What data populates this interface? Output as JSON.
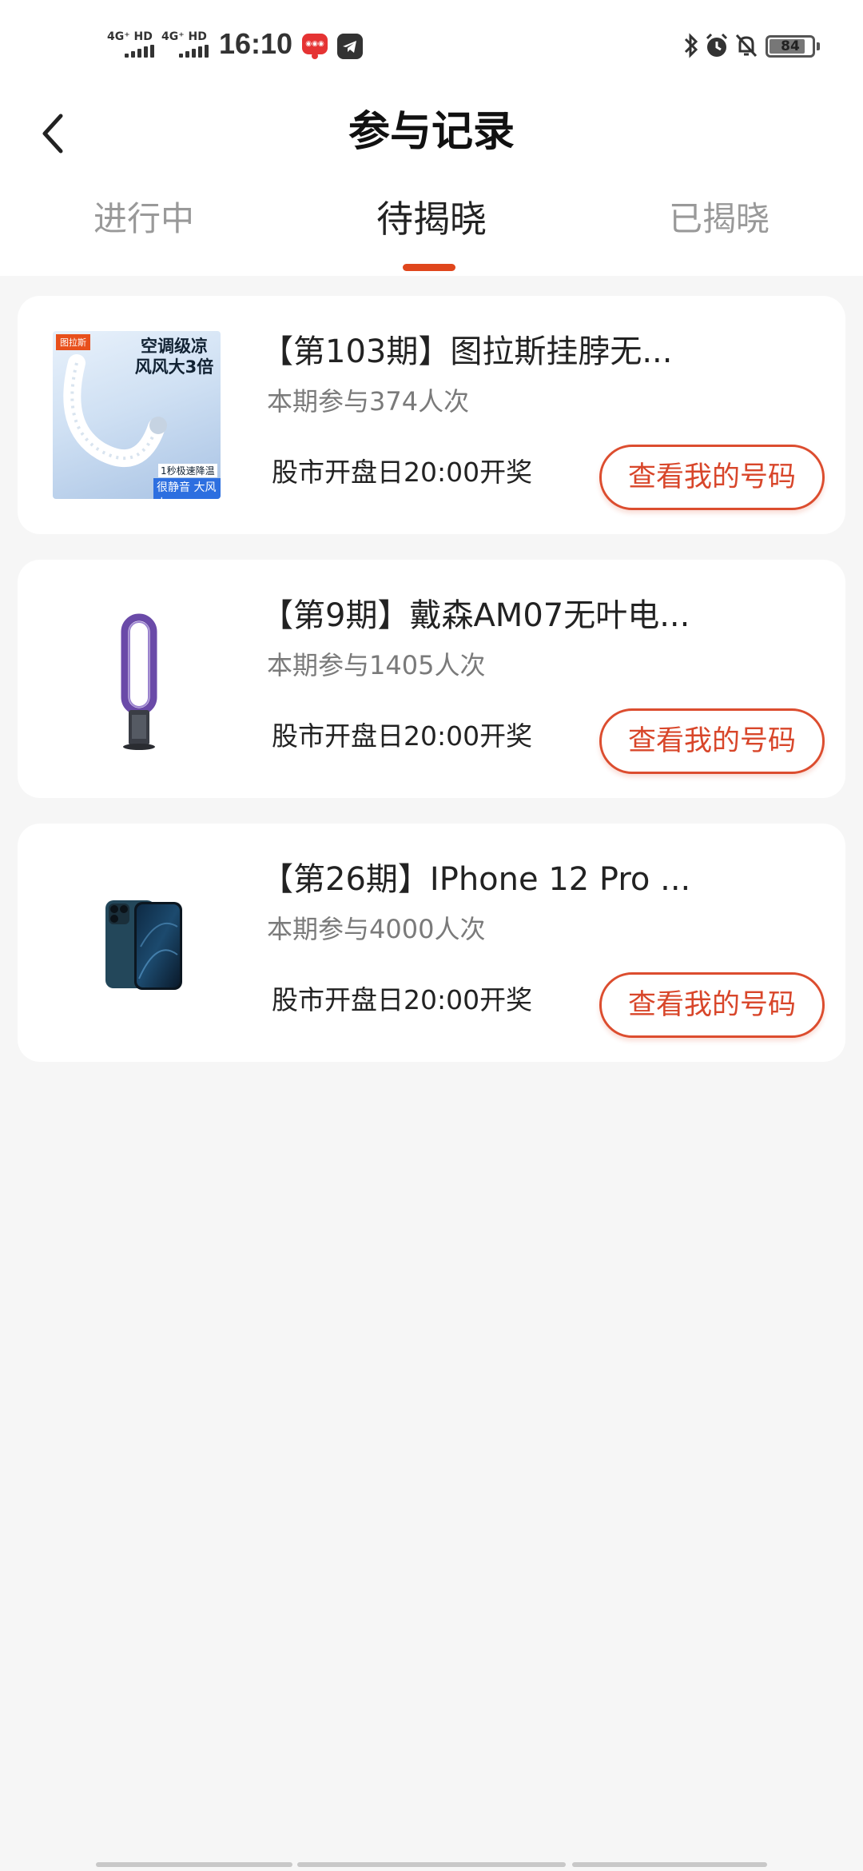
{
  "status_bar": {
    "time": "16:10",
    "signal1_label": "4G⁺ HD",
    "signal2_label": "4G⁺ HD",
    "battery": "84",
    "battery_level": 0.84
  },
  "header": {
    "title": "参与记录",
    "back_icon": "chevron-left-icon"
  },
  "tabs": [
    {
      "label": "进行中",
      "active": false
    },
    {
      "label": "待揭晓",
      "active": true
    },
    {
      "label": "已揭晓",
      "active": false
    }
  ],
  "accent_color": "#e0461c",
  "records": [
    {
      "title": "【第103期】图拉斯挂脖无...",
      "participants": "本期参与374人次",
      "draw_time": "股市开盘日20:00开奖",
      "button": "查看我的号码",
      "image": {
        "brand_tag": "图拉斯",
        "headline": "空调级凉风风大3倍",
        "caption1": "1秒极速降温",
        "caption2": "很静音 大风力"
      }
    },
    {
      "title": "【第9期】戴森AM07无叶电...",
      "participants": "本期参与1405人次",
      "draw_time": "股市开盘日20:00开奖",
      "button": "查看我的号码"
    },
    {
      "title": "【第26期】IPhone 12 Pro ...",
      "participants": "本期参与4000人次",
      "draw_time": "股市开盘日20:00开奖",
      "button": "查看我的号码"
    }
  ]
}
